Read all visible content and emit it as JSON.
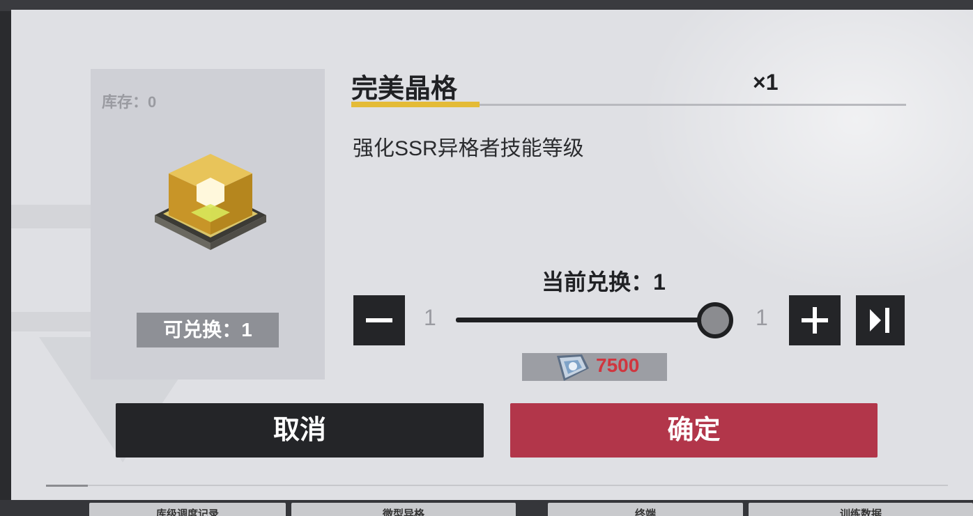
{
  "background": {
    "tabs": [
      "库级调度记录",
      "微型异格",
      "终端",
      "训练数据"
    ]
  },
  "item": {
    "stock_label": "库存：0",
    "exchangeable_label": "可兑换：1",
    "name": "完美晶格",
    "quantity": "×1",
    "description": "强化SSR异格者技能等级"
  },
  "exchange": {
    "current_label": "当前兑换：1",
    "min": "1",
    "max": "1",
    "slider_fraction": 1.0,
    "cost_value": "7500"
  },
  "buttons": {
    "cancel": "取消",
    "confirm": "确定"
  },
  "colors": {
    "accent": "#e4bb37",
    "confirm": "#b2364a",
    "cost": "#d0363f"
  },
  "icons": [
    "minus-icon",
    "plus-icon",
    "max-icon",
    "crystal-currency-icon",
    "lattice-crystal-item"
  ]
}
